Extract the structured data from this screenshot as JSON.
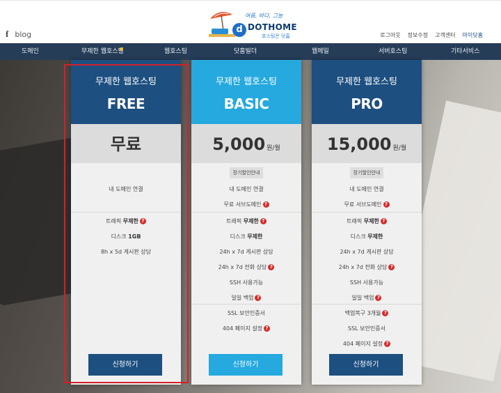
{
  "header": {
    "social_fb": "f",
    "social_blog": "blog",
    "logo_slogan": "여름, 바다, 그늘",
    "logo_mark": "d",
    "logo_name": "DOTHOME",
    "logo_sub": "호스팅은 닷홈",
    "utils": [
      "로그아웃",
      "정보수정",
      "고객센터",
      "마이닷홈"
    ]
  },
  "nav": {
    "items": [
      "도메인",
      "무제한 웹호스팅",
      "웹호스팅",
      "닷홈빌더",
      "웹메일",
      "서버호스팅",
      "기타서비스"
    ]
  },
  "plans": [
    {
      "subtitle": "무제한 웹호스팅",
      "name": "FREE",
      "price": "무료",
      "unit": "",
      "header_color": "#1d4f80",
      "button_color": "#1d4f80",
      "button_label": "신청하기",
      "f1": "내 도메인 연결",
      "f2": "트래픽 ",
      "f2b": "무제한",
      "f3": "디스크 ",
      "f3b": "1GB",
      "f4": "8h x 5d 게시판 상담"
    },
    {
      "subtitle": "무제한 웹호스팅",
      "name": "BASIC",
      "price": "5,000",
      "unit": "원/월",
      "header_color": "#25a9df",
      "button_color": "#25a9df",
      "button_label": "신청하기",
      "tag": "장기할인안내",
      "f1": "내 도메인 연결",
      "f2": "무료 서브도메인",
      "f3": "트래픽 ",
      "f3b": "무제한",
      "f4": "디스크 ",
      "f4b": "무제한",
      "f5": "24h x 7d 게시판 상담",
      "f6": "24h x 7d 전화 상담",
      "f7": "SSH 사용가능",
      "f8": "일일 백업",
      "f9": "SSL 보안인증서",
      "f10": "404 페이지 설정"
    },
    {
      "subtitle": "무제한 웹호스팅",
      "name": "PRO",
      "price": "15,000",
      "unit": "원/월",
      "header_color": "#1d4f80",
      "button_color": "#1d4f80",
      "button_label": "신청하기",
      "tag": "장기할인안내",
      "f1": "내 도메인 연결",
      "f2": "무료 서브도메인",
      "f3": "트래픽 ",
      "f3b": "무제한",
      "f4": "디스크 ",
      "f4b": "무제한",
      "f5": "24h x 7d 게시판 상담",
      "f6": "24h x 7d 전화 상담",
      "f7": "SSH 사용가능",
      "f8": "일일 백업",
      "f9": "백업복구 3개월",
      "f10": "SSL 보안인증서",
      "f11": "404 페이지 설정"
    }
  ]
}
